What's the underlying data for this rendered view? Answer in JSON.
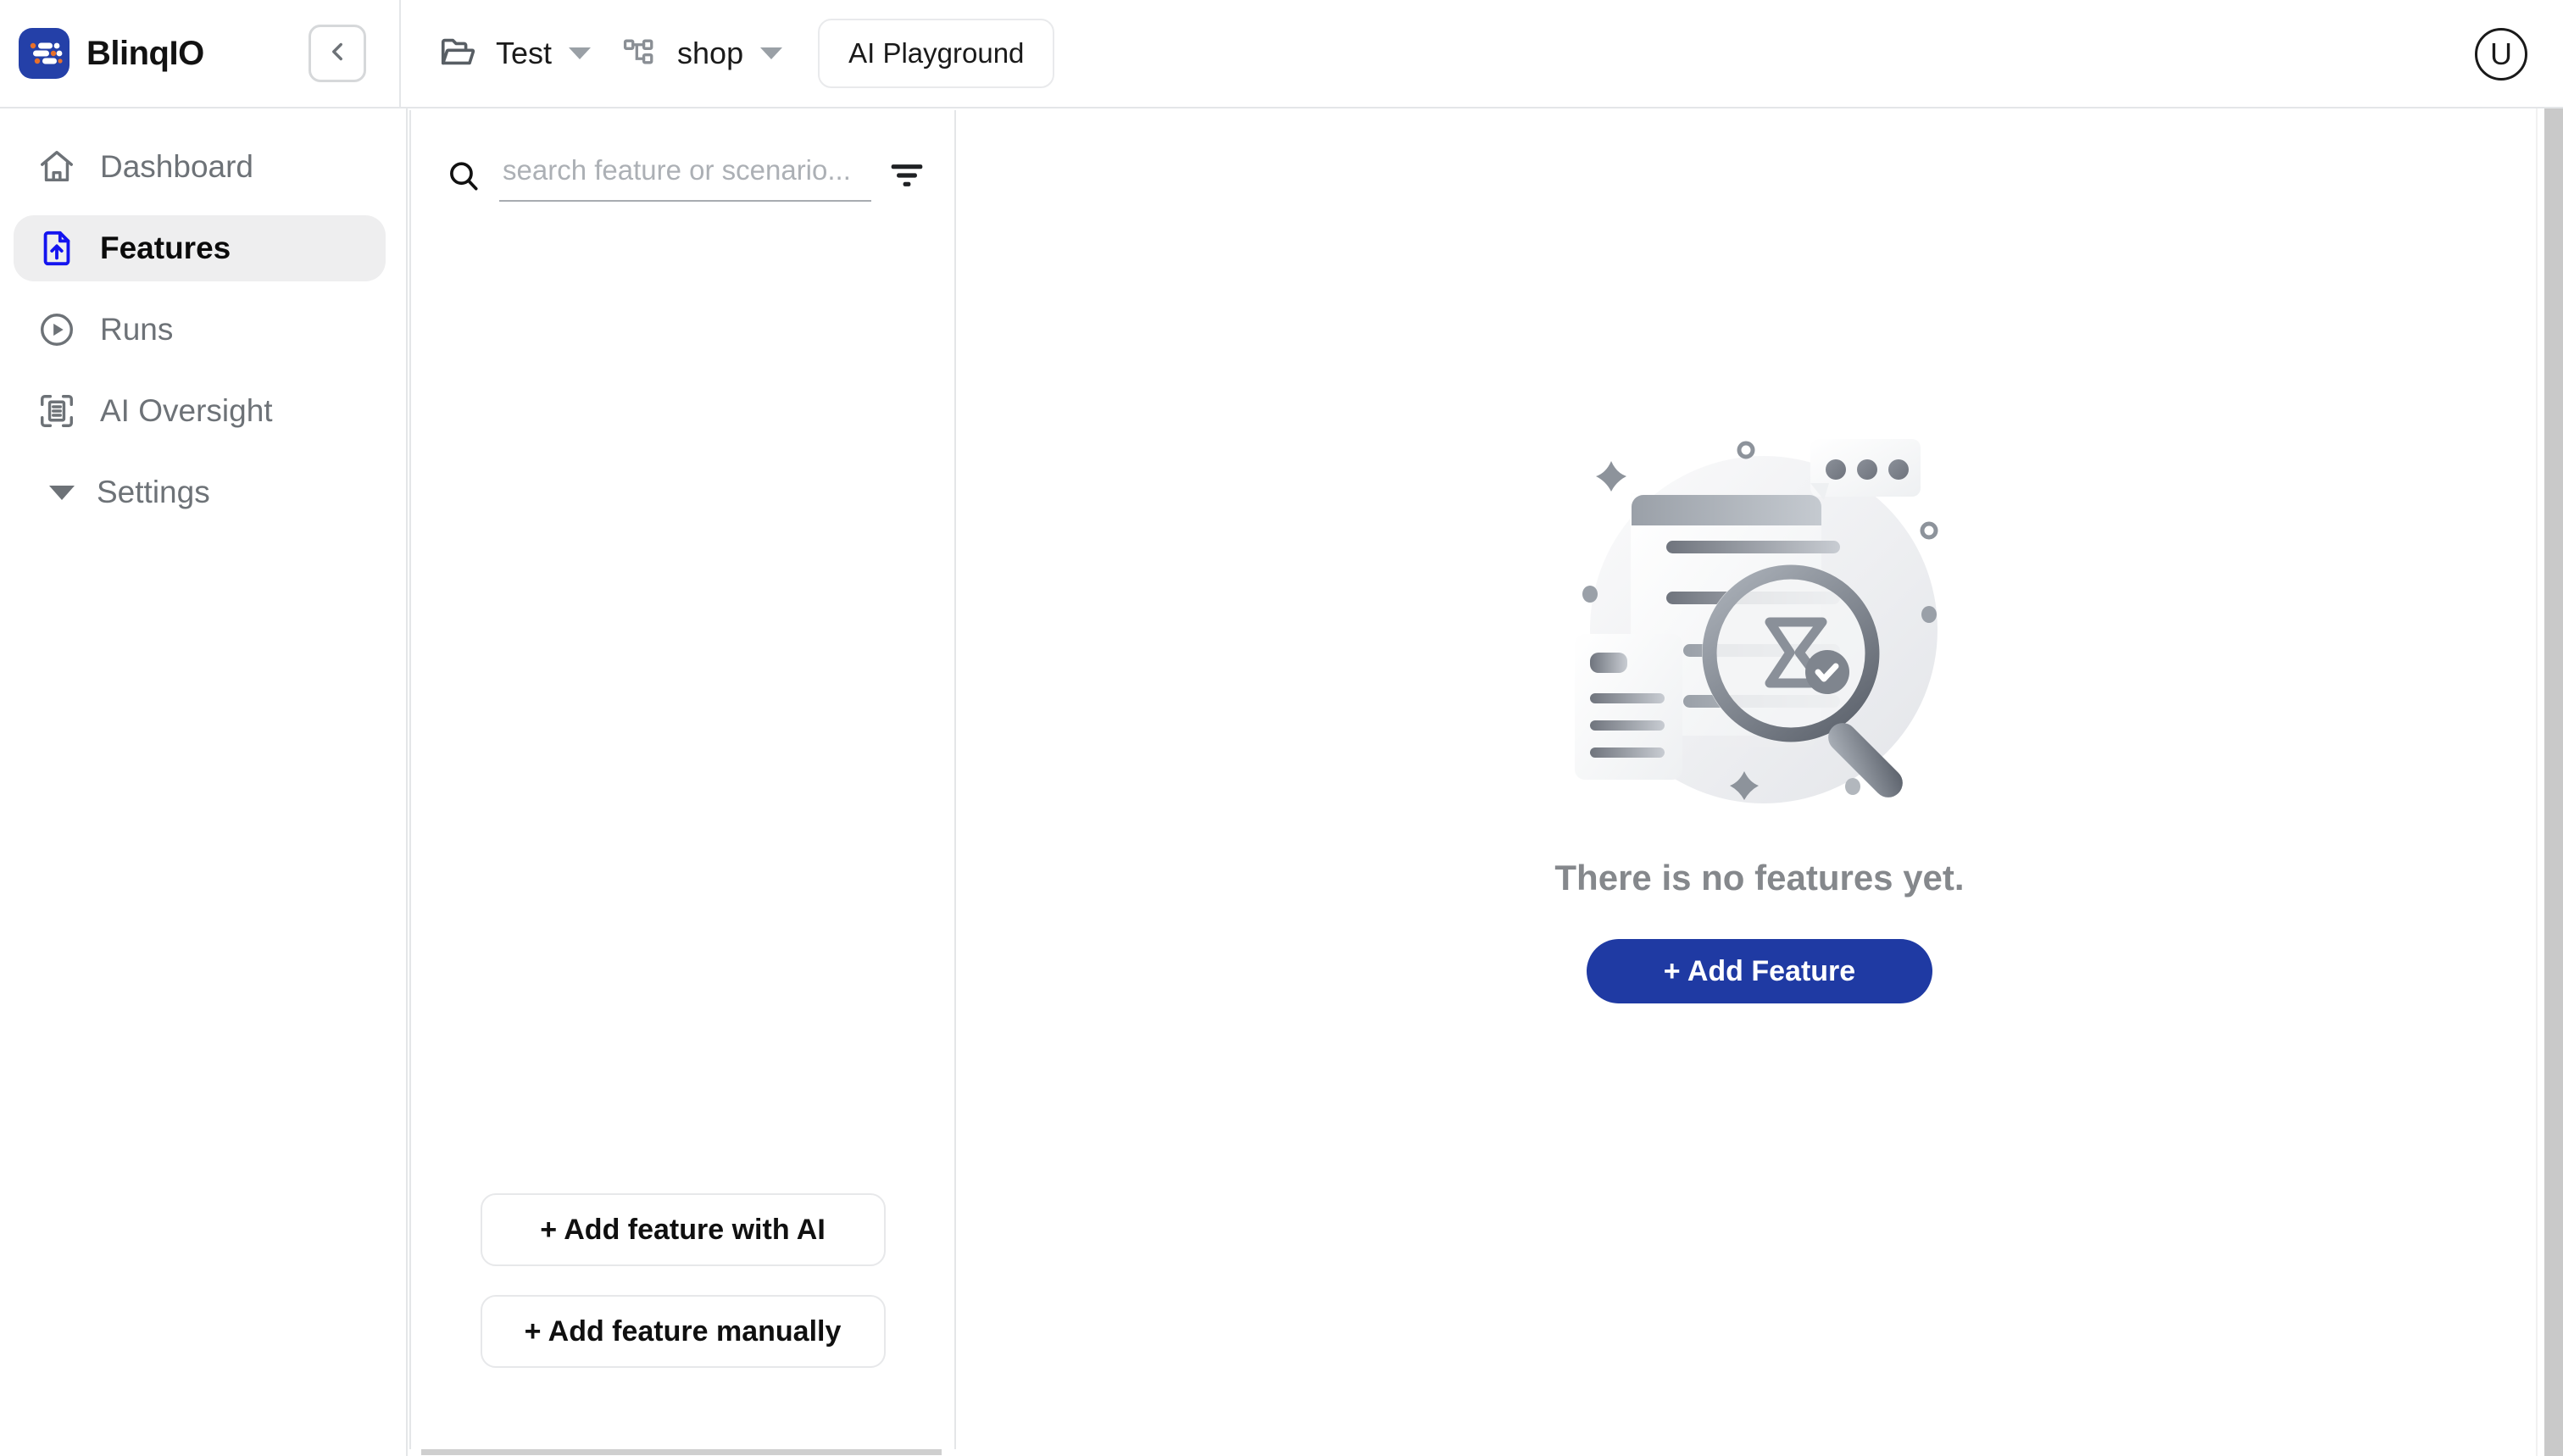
{
  "brand": {
    "name": "BlinqIO",
    "logo_icon": "blinqio-logo-icon",
    "logo_color": "#2440a8",
    "accent_orange": "#e8702a"
  },
  "header": {
    "collapse_icon": "chevron-left-icon",
    "breadcrumbs": [
      {
        "icon": "folder-open-icon",
        "label": "Test",
        "caret": "chevron-down-icon"
      },
      {
        "icon": "sitemap-icon",
        "label": "shop",
        "caret": "chevron-down-icon"
      }
    ],
    "playground_button": "AI Playground",
    "avatar_initial": "U"
  },
  "sidebar": {
    "items": [
      {
        "label": "Dashboard",
        "icon": "home-icon",
        "active": false
      },
      {
        "label": "Features",
        "icon": "file-upload-icon",
        "active": true
      },
      {
        "label": "Runs",
        "icon": "play-circle-icon",
        "active": false
      },
      {
        "label": "AI Oversight",
        "icon": "scan-document-icon",
        "active": false
      }
    ],
    "settings": {
      "label": "Settings",
      "icon": "triangle-down-icon"
    }
  },
  "feature_panel": {
    "search": {
      "icon": "search-icon",
      "placeholder": "search feature or scenario...",
      "value": ""
    },
    "filter_icon": "filter-icon",
    "actions": [
      "+ Add feature with AI",
      "+ Add feature manually"
    ]
  },
  "main": {
    "illustration_icon": "empty-features-illustration",
    "empty_message": "There is no features yet.",
    "add_feature_button": "+ Add Feature",
    "primary_color": "#1f3aa3"
  }
}
